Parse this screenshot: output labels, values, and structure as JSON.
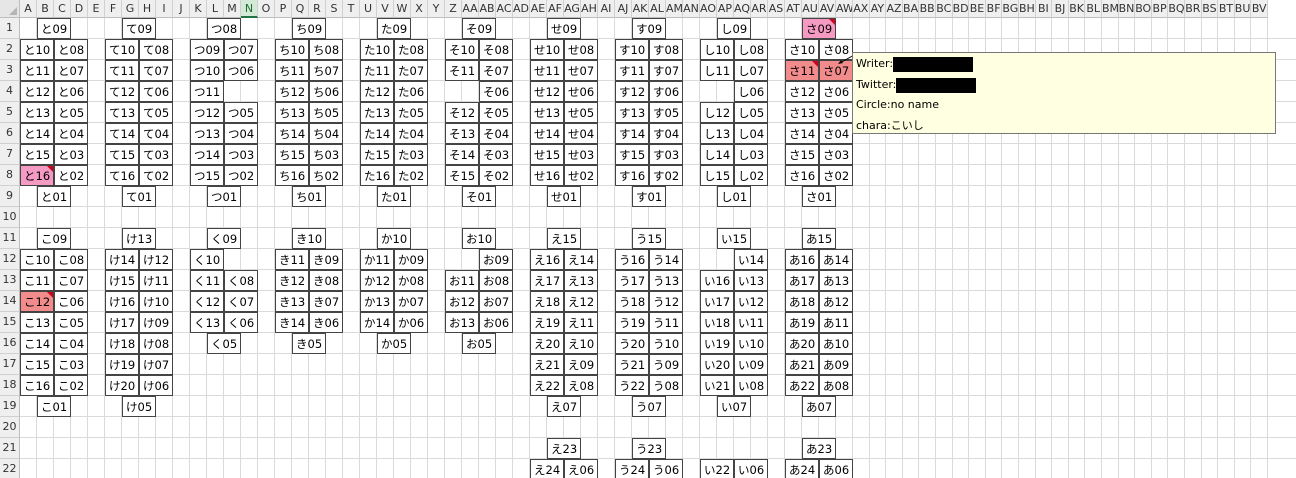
{
  "column_headers": [
    "A",
    "B",
    "C",
    "D",
    "E",
    "F",
    "G",
    "H",
    "I",
    "J",
    "K",
    "L",
    "M",
    "N",
    "O",
    "P",
    "Q",
    "R",
    "S",
    "T",
    "U",
    "V",
    "W",
    "X",
    "Y",
    "Z",
    "AA",
    "AB",
    "AC",
    "AD",
    "AE",
    "AF",
    "AG",
    "AH",
    "AI",
    "AJ",
    "AK",
    "AL",
    "AM",
    "AN",
    "AO",
    "AP",
    "AQ",
    "AR",
    "AS",
    "AT",
    "AU",
    "AV",
    "AW",
    "AX",
    "AY",
    "AZ",
    "BA",
    "BB",
    "BC",
    "BD",
    "BE",
    "BF",
    "BG",
    "BH",
    "BI",
    "BJ",
    "BK",
    "BL",
    "BM",
    "BN",
    "BO",
    "BP",
    "BQ",
    "BR",
    "BS",
    "BT",
    "BU",
    "BV"
  ],
  "selected_column": "N",
  "row_headers": [
    "1",
    "2",
    "3",
    "4",
    "5",
    "6",
    "7",
    "8",
    "9",
    "10",
    "11",
    "12",
    "13",
    "14",
    "15",
    "16",
    "17",
    "18",
    "19",
    "20",
    "21",
    "22"
  ],
  "cells": [
    {
      "r": 1,
      "c": "B",
      "t": "と09"
    },
    {
      "r": 2,
      "c": "A",
      "t": "と10"
    },
    {
      "r": 2,
      "c": "C",
      "t": "と08"
    },
    {
      "r": 3,
      "c": "A",
      "t": "と11"
    },
    {
      "r": 3,
      "c": "C",
      "t": "と07"
    },
    {
      "r": 4,
      "c": "A",
      "t": "と12"
    },
    {
      "r": 4,
      "c": "C",
      "t": "と06"
    },
    {
      "r": 5,
      "c": "A",
      "t": "と13"
    },
    {
      "r": 5,
      "c": "C",
      "t": "と05"
    },
    {
      "r": 6,
      "c": "A",
      "t": "と14"
    },
    {
      "r": 6,
      "c": "C",
      "t": "と04"
    },
    {
      "r": 7,
      "c": "A",
      "t": "と15"
    },
    {
      "r": 7,
      "c": "C",
      "t": "と03"
    },
    {
      "r": 8,
      "c": "A",
      "t": "と16",
      "hl": "pink",
      "note": true
    },
    {
      "r": 8,
      "c": "C",
      "t": "と02"
    },
    {
      "r": 9,
      "c": "B",
      "t": "と01"
    },
    {
      "r": 11,
      "c": "B",
      "t": "こ09"
    },
    {
      "r": 12,
      "c": "A",
      "t": "こ10"
    },
    {
      "r": 12,
      "c": "C",
      "t": "こ08"
    },
    {
      "r": 13,
      "c": "A",
      "t": "こ11"
    },
    {
      "r": 13,
      "c": "C",
      "t": "こ07"
    },
    {
      "r": 14,
      "c": "A",
      "t": "こ12",
      "hl": "red",
      "note": true
    },
    {
      "r": 14,
      "c": "C",
      "t": "こ06"
    },
    {
      "r": 15,
      "c": "A",
      "t": "こ13"
    },
    {
      "r": 15,
      "c": "C",
      "t": "こ05"
    },
    {
      "r": 16,
      "c": "A",
      "t": "こ14"
    },
    {
      "r": 16,
      "c": "C",
      "t": "こ04"
    },
    {
      "r": 17,
      "c": "A",
      "t": "こ15"
    },
    {
      "r": 17,
      "c": "C",
      "t": "こ03"
    },
    {
      "r": 18,
      "c": "A",
      "t": "こ16"
    },
    {
      "r": 18,
      "c": "C",
      "t": "こ02"
    },
    {
      "r": 19,
      "c": "B",
      "t": "こ01"
    },
    {
      "r": 1,
      "c": "G",
      "t": "て09"
    },
    {
      "r": 2,
      "c": "F",
      "t": "て10"
    },
    {
      "r": 2,
      "c": "H",
      "t": "て08"
    },
    {
      "r": 3,
      "c": "F",
      "t": "て11"
    },
    {
      "r": 3,
      "c": "H",
      "t": "て07"
    },
    {
      "r": 4,
      "c": "F",
      "t": "て12"
    },
    {
      "r": 4,
      "c": "H",
      "t": "て06"
    },
    {
      "r": 5,
      "c": "F",
      "t": "て13"
    },
    {
      "r": 5,
      "c": "H",
      "t": "て05"
    },
    {
      "r": 6,
      "c": "F",
      "t": "て14"
    },
    {
      "r": 6,
      "c": "H",
      "t": "て04"
    },
    {
      "r": 7,
      "c": "F",
      "t": "て15"
    },
    {
      "r": 7,
      "c": "H",
      "t": "て03"
    },
    {
      "r": 8,
      "c": "F",
      "t": "て16"
    },
    {
      "r": 8,
      "c": "H",
      "t": "て02"
    },
    {
      "r": 9,
      "c": "G",
      "t": "て01"
    },
    {
      "r": 11,
      "c": "G",
      "t": "け13"
    },
    {
      "r": 12,
      "c": "F",
      "t": "け14"
    },
    {
      "r": 12,
      "c": "H",
      "t": "け12"
    },
    {
      "r": 13,
      "c": "F",
      "t": "け15"
    },
    {
      "r": 13,
      "c": "H",
      "t": "け11"
    },
    {
      "r": 14,
      "c": "F",
      "t": "け16"
    },
    {
      "r": 14,
      "c": "H",
      "t": "け10"
    },
    {
      "r": 15,
      "c": "F",
      "t": "け17"
    },
    {
      "r": 15,
      "c": "H",
      "t": "け09"
    },
    {
      "r": 16,
      "c": "F",
      "t": "け18"
    },
    {
      "r": 16,
      "c": "H",
      "t": "け08"
    },
    {
      "r": 17,
      "c": "F",
      "t": "け19"
    },
    {
      "r": 17,
      "c": "H",
      "t": "け07"
    },
    {
      "r": 18,
      "c": "F",
      "t": "け20"
    },
    {
      "r": 18,
      "c": "H",
      "t": "け06"
    },
    {
      "r": 19,
      "c": "G",
      "t": "け05"
    },
    {
      "r": 1,
      "c": "L",
      "t": "つ08"
    },
    {
      "r": 2,
      "c": "K",
      "t": "つ09"
    },
    {
      "r": 2,
      "c": "M",
      "t": "つ07"
    },
    {
      "r": 3,
      "c": "K",
      "t": "つ10"
    },
    {
      "r": 3,
      "c": "M",
      "t": "つ06"
    },
    {
      "r": 4,
      "c": "K",
      "t": "つ11"
    },
    {
      "r": 5,
      "c": "K",
      "t": "つ12"
    },
    {
      "r": 5,
      "c": "M",
      "t": "つ05"
    },
    {
      "r": 6,
      "c": "K",
      "t": "つ13"
    },
    {
      "r": 6,
      "c": "M",
      "t": "つ04"
    },
    {
      "r": 7,
      "c": "K",
      "t": "つ14"
    },
    {
      "r": 7,
      "c": "M",
      "t": "つ03"
    },
    {
      "r": 8,
      "c": "K",
      "t": "つ15"
    },
    {
      "r": 8,
      "c": "M",
      "t": "つ02"
    },
    {
      "r": 9,
      "c": "L",
      "t": "つ01"
    },
    {
      "r": 11,
      "c": "L",
      "t": "く09"
    },
    {
      "r": 12,
      "c": "K",
      "t": "く10"
    },
    {
      "r": 13,
      "c": "K",
      "t": "く11"
    },
    {
      "r": 13,
      "c": "M",
      "t": "く08"
    },
    {
      "r": 14,
      "c": "K",
      "t": "く12"
    },
    {
      "r": 14,
      "c": "M",
      "t": "く07"
    },
    {
      "r": 15,
      "c": "K",
      "t": "く13"
    },
    {
      "r": 15,
      "c": "M",
      "t": "く06"
    },
    {
      "r": 16,
      "c": "L",
      "t": "く05"
    },
    {
      "r": 1,
      "c": "Q",
      "t": "ち09"
    },
    {
      "r": 2,
      "c": "P",
      "t": "ち10"
    },
    {
      "r": 2,
      "c": "R",
      "t": "ち08"
    },
    {
      "r": 3,
      "c": "P",
      "t": "ち11"
    },
    {
      "r": 3,
      "c": "R",
      "t": "ち07"
    },
    {
      "r": 4,
      "c": "P",
      "t": "ち12"
    },
    {
      "r": 4,
      "c": "R",
      "t": "ち06"
    },
    {
      "r": 5,
      "c": "P",
      "t": "ち13"
    },
    {
      "r": 5,
      "c": "R",
      "t": "ち05"
    },
    {
      "r": 6,
      "c": "P",
      "t": "ち14"
    },
    {
      "r": 6,
      "c": "R",
      "t": "ち04"
    },
    {
      "r": 7,
      "c": "P",
      "t": "ち15"
    },
    {
      "r": 7,
      "c": "R",
      "t": "ち03"
    },
    {
      "r": 8,
      "c": "P",
      "t": "ち16"
    },
    {
      "r": 8,
      "c": "R",
      "t": "ち02"
    },
    {
      "r": 9,
      "c": "Q",
      "t": "ち01"
    },
    {
      "r": 11,
      "c": "Q",
      "t": "き10"
    },
    {
      "r": 12,
      "c": "P",
      "t": "き11"
    },
    {
      "r": 12,
      "c": "R",
      "t": "き09"
    },
    {
      "r": 13,
      "c": "P",
      "t": "き12"
    },
    {
      "r": 13,
      "c": "R",
      "t": "き08"
    },
    {
      "r": 14,
      "c": "P",
      "t": "き13"
    },
    {
      "r": 14,
      "c": "R",
      "t": "き07"
    },
    {
      "r": 15,
      "c": "P",
      "t": "き14"
    },
    {
      "r": 15,
      "c": "R",
      "t": "き06"
    },
    {
      "r": 16,
      "c": "Q",
      "t": "き05"
    },
    {
      "r": 1,
      "c": "V",
      "t": "た09"
    },
    {
      "r": 2,
      "c": "U",
      "t": "た10"
    },
    {
      "r": 2,
      "c": "W",
      "t": "た08"
    },
    {
      "r": 3,
      "c": "U",
      "t": "た11"
    },
    {
      "r": 3,
      "c": "W",
      "t": "た07"
    },
    {
      "r": 4,
      "c": "U",
      "t": "た12"
    },
    {
      "r": 4,
      "c": "W",
      "t": "た06"
    },
    {
      "r": 5,
      "c": "U",
      "t": "た13"
    },
    {
      "r": 5,
      "c": "W",
      "t": "た05"
    },
    {
      "r": 6,
      "c": "U",
      "t": "た14"
    },
    {
      "r": 6,
      "c": "W",
      "t": "た04"
    },
    {
      "r": 7,
      "c": "U",
      "t": "た15"
    },
    {
      "r": 7,
      "c": "W",
      "t": "た03"
    },
    {
      "r": 8,
      "c": "U",
      "t": "た16"
    },
    {
      "r": 8,
      "c": "W",
      "t": "た02"
    },
    {
      "r": 9,
      "c": "V",
      "t": "た01"
    },
    {
      "r": 11,
      "c": "V",
      "t": "か10"
    },
    {
      "r": 12,
      "c": "U",
      "t": "か11"
    },
    {
      "r": 12,
      "c": "W",
      "t": "か09"
    },
    {
      "r": 13,
      "c": "U",
      "t": "か12"
    },
    {
      "r": 13,
      "c": "W",
      "t": "か08"
    },
    {
      "r": 14,
      "c": "U",
      "t": "か13"
    },
    {
      "r": 14,
      "c": "W",
      "t": "か07"
    },
    {
      "r": 15,
      "c": "U",
      "t": "か14"
    },
    {
      "r": 15,
      "c": "W",
      "t": "か06"
    },
    {
      "r": 16,
      "c": "V",
      "t": "か05"
    },
    {
      "r": 1,
      "c": "AA",
      "t": "そ09"
    },
    {
      "r": 2,
      "c": "Z",
      "t": "そ10"
    },
    {
      "r": 2,
      "c": "AB",
      "t": "そ08"
    },
    {
      "r": 3,
      "c": "Z",
      "t": "そ11"
    },
    {
      "r": 3,
      "c": "AB",
      "t": "そ07"
    },
    {
      "r": 4,
      "c": "AB",
      "t": "そ06"
    },
    {
      "r": 5,
      "c": "Z",
      "t": "そ12"
    },
    {
      "r": 5,
      "c": "AB",
      "t": "そ05"
    },
    {
      "r": 6,
      "c": "Z",
      "t": "そ13"
    },
    {
      "r": 6,
      "c": "AB",
      "t": "そ04"
    },
    {
      "r": 7,
      "c": "Z",
      "t": "そ14"
    },
    {
      "r": 7,
      "c": "AB",
      "t": "そ03"
    },
    {
      "r": 8,
      "c": "Z",
      "t": "そ15"
    },
    {
      "r": 8,
      "c": "AB",
      "t": "そ02"
    },
    {
      "r": 9,
      "c": "AA",
      "t": "そ01"
    },
    {
      "r": 11,
      "c": "AA",
      "t": "お10"
    },
    {
      "r": 12,
      "c": "AB",
      "t": "お09"
    },
    {
      "r": 13,
      "c": "Z",
      "t": "お11"
    },
    {
      "r": 13,
      "c": "AB",
      "t": "お08"
    },
    {
      "r": 14,
      "c": "Z",
      "t": "お12"
    },
    {
      "r": 14,
      "c": "AB",
      "t": "お07"
    },
    {
      "r": 15,
      "c": "Z",
      "t": "お13"
    },
    {
      "r": 15,
      "c": "AB",
      "t": "お06"
    },
    {
      "r": 16,
      "c": "AA",
      "t": "お05"
    },
    {
      "r": 1,
      "c": "AF",
      "t": "せ09"
    },
    {
      "r": 2,
      "c": "AE",
      "t": "せ10"
    },
    {
      "r": 2,
      "c": "AG",
      "t": "せ08"
    },
    {
      "r": 3,
      "c": "AE",
      "t": "せ11"
    },
    {
      "r": 3,
      "c": "AG",
      "t": "せ07"
    },
    {
      "r": 4,
      "c": "AE",
      "t": "せ12"
    },
    {
      "r": 4,
      "c": "AG",
      "t": "せ06"
    },
    {
      "r": 5,
      "c": "AE",
      "t": "せ13"
    },
    {
      "r": 5,
      "c": "AG",
      "t": "せ05"
    },
    {
      "r": 6,
      "c": "AE",
      "t": "せ14"
    },
    {
      "r": 6,
      "c": "AG",
      "t": "せ04"
    },
    {
      "r": 7,
      "c": "AE",
      "t": "せ15"
    },
    {
      "r": 7,
      "c": "AG",
      "t": "せ03"
    },
    {
      "r": 8,
      "c": "AE",
      "t": "せ16"
    },
    {
      "r": 8,
      "c": "AG",
      "t": "せ02"
    },
    {
      "r": 9,
      "c": "AF",
      "t": "せ01"
    },
    {
      "r": 11,
      "c": "AF",
      "t": "え15"
    },
    {
      "r": 12,
      "c": "AE",
      "t": "え16"
    },
    {
      "r": 12,
      "c": "AG",
      "t": "え14"
    },
    {
      "r": 13,
      "c": "AE",
      "t": "え17"
    },
    {
      "r": 13,
      "c": "AG",
      "t": "え13"
    },
    {
      "r": 14,
      "c": "AE",
      "t": "え18"
    },
    {
      "r": 14,
      "c": "AG",
      "t": "え12"
    },
    {
      "r": 15,
      "c": "AE",
      "t": "え19"
    },
    {
      "r": 15,
      "c": "AG",
      "t": "え11"
    },
    {
      "r": 16,
      "c": "AE",
      "t": "え20"
    },
    {
      "r": 16,
      "c": "AG",
      "t": "え10"
    },
    {
      "r": 17,
      "c": "AE",
      "t": "え21"
    },
    {
      "r": 17,
      "c": "AG",
      "t": "え09"
    },
    {
      "r": 18,
      "c": "AE",
      "t": "え22"
    },
    {
      "r": 18,
      "c": "AG",
      "t": "え08"
    },
    {
      "r": 19,
      "c": "AF",
      "t": "え07"
    },
    {
      "r": 21,
      "c": "AF",
      "t": "え23"
    },
    {
      "r": 22,
      "c": "AE",
      "t": "え24"
    },
    {
      "r": 22,
      "c": "AG",
      "t": "え06"
    },
    {
      "r": 1,
      "c": "AK",
      "t": "す09"
    },
    {
      "r": 2,
      "c": "AJ",
      "t": "す10"
    },
    {
      "r": 2,
      "c": "AL",
      "t": "す08"
    },
    {
      "r": 3,
      "c": "AJ",
      "t": "す11"
    },
    {
      "r": 3,
      "c": "AL",
      "t": "す07"
    },
    {
      "r": 4,
      "c": "AJ",
      "t": "す12"
    },
    {
      "r": 4,
      "c": "AL",
      "t": "す06"
    },
    {
      "r": 5,
      "c": "AJ",
      "t": "す13"
    },
    {
      "r": 5,
      "c": "AL",
      "t": "す05"
    },
    {
      "r": 6,
      "c": "AJ",
      "t": "す14"
    },
    {
      "r": 6,
      "c": "AL",
      "t": "す04"
    },
    {
      "r": 7,
      "c": "AJ",
      "t": "す15"
    },
    {
      "r": 7,
      "c": "AL",
      "t": "す03"
    },
    {
      "r": 8,
      "c": "AJ",
      "t": "す16"
    },
    {
      "r": 8,
      "c": "AL",
      "t": "す02"
    },
    {
      "r": 9,
      "c": "AK",
      "t": "す01"
    },
    {
      "r": 11,
      "c": "AK",
      "t": "う15"
    },
    {
      "r": 12,
      "c": "AJ",
      "t": "う16"
    },
    {
      "r": 12,
      "c": "AL",
      "t": "う14"
    },
    {
      "r": 13,
      "c": "AJ",
      "t": "う17"
    },
    {
      "r": 13,
      "c": "AL",
      "t": "う13"
    },
    {
      "r": 14,
      "c": "AJ",
      "t": "う18"
    },
    {
      "r": 14,
      "c": "AL",
      "t": "う12"
    },
    {
      "r": 15,
      "c": "AJ",
      "t": "う19"
    },
    {
      "r": 15,
      "c": "AL",
      "t": "う11"
    },
    {
      "r": 16,
      "c": "AJ",
      "t": "う20"
    },
    {
      "r": 16,
      "c": "AL",
      "t": "う10"
    },
    {
      "r": 17,
      "c": "AJ",
      "t": "う21"
    },
    {
      "r": 17,
      "c": "AL",
      "t": "う09"
    },
    {
      "r": 18,
      "c": "AJ",
      "t": "う22"
    },
    {
      "r": 18,
      "c": "AL",
      "t": "う08"
    },
    {
      "r": 19,
      "c": "AK",
      "t": "う07"
    },
    {
      "r": 21,
      "c": "AK",
      "t": "う23"
    },
    {
      "r": 22,
      "c": "AJ",
      "t": "う24"
    },
    {
      "r": 22,
      "c": "AL",
      "t": "う06"
    },
    {
      "r": 1,
      "c": "AP",
      "t": "し09"
    },
    {
      "r": 2,
      "c": "AO",
      "t": "し10"
    },
    {
      "r": 2,
      "c": "AQ",
      "t": "し08"
    },
    {
      "r": 3,
      "c": "AO",
      "t": "し11"
    },
    {
      "r": 3,
      "c": "AQ",
      "t": "し07"
    },
    {
      "r": 4,
      "c": "AQ",
      "t": "し06"
    },
    {
      "r": 5,
      "c": "AO",
      "t": "し12"
    },
    {
      "r": 5,
      "c": "AQ",
      "t": "し05"
    },
    {
      "r": 6,
      "c": "AO",
      "t": "し13"
    },
    {
      "r": 6,
      "c": "AQ",
      "t": "し04"
    },
    {
      "r": 7,
      "c": "AO",
      "t": "し14"
    },
    {
      "r": 7,
      "c": "AQ",
      "t": "し03"
    },
    {
      "r": 8,
      "c": "AO",
      "t": "し15"
    },
    {
      "r": 8,
      "c": "AQ",
      "t": "し02"
    },
    {
      "r": 9,
      "c": "AP",
      "t": "し01"
    },
    {
      "r": 11,
      "c": "AP",
      "t": "い15"
    },
    {
      "r": 12,
      "c": "AQ",
      "t": "い14"
    },
    {
      "r": 13,
      "c": "AO",
      "t": "い16"
    },
    {
      "r": 13,
      "c": "AQ",
      "t": "い13"
    },
    {
      "r": 14,
      "c": "AO",
      "t": "い17"
    },
    {
      "r": 14,
      "c": "AQ",
      "t": "い12"
    },
    {
      "r": 15,
      "c": "AO",
      "t": "い18"
    },
    {
      "r": 15,
      "c": "AQ",
      "t": "い11"
    },
    {
      "r": 16,
      "c": "AO",
      "t": "い19"
    },
    {
      "r": 16,
      "c": "AQ",
      "t": "い10"
    },
    {
      "r": 17,
      "c": "AO",
      "t": "い20"
    },
    {
      "r": 17,
      "c": "AQ",
      "t": "い09"
    },
    {
      "r": 18,
      "c": "AO",
      "t": "い21"
    },
    {
      "r": 18,
      "c": "AQ",
      "t": "い08"
    },
    {
      "r": 19,
      "c": "AP",
      "t": "い07"
    },
    {
      "r": 22,
      "c": "AO",
      "t": "い22"
    },
    {
      "r": 22,
      "c": "AQ",
      "t": "い06"
    },
    {
      "r": 1,
      "c": "AU",
      "t": "さ09",
      "hl": "pink",
      "note": true
    },
    {
      "r": 2,
      "c": "AT",
      "t": "さ10"
    },
    {
      "r": 2,
      "c": "AV",
      "t": "さ08"
    },
    {
      "r": 3,
      "c": "AT",
      "t": "さ11",
      "hl": "red",
      "note": true
    },
    {
      "r": 3,
      "c": "AV",
      "t": "さ07",
      "hl": "red"
    },
    {
      "r": 4,
      "c": "AT",
      "t": "さ12"
    },
    {
      "r": 4,
      "c": "AV",
      "t": "さ06"
    },
    {
      "r": 5,
      "c": "AT",
      "t": "さ13"
    },
    {
      "r": 5,
      "c": "AV",
      "t": "さ05"
    },
    {
      "r": 6,
      "c": "AT",
      "t": "さ14"
    },
    {
      "r": 6,
      "c": "AV",
      "t": "さ04"
    },
    {
      "r": 7,
      "c": "AT",
      "t": "さ15"
    },
    {
      "r": 7,
      "c": "AV",
      "t": "さ03"
    },
    {
      "r": 8,
      "c": "AT",
      "t": "さ16"
    },
    {
      "r": 8,
      "c": "AV",
      "t": "さ02"
    },
    {
      "r": 9,
      "c": "AU",
      "t": "さ01"
    },
    {
      "r": 11,
      "c": "AU",
      "t": "あ15"
    },
    {
      "r": 12,
      "c": "AT",
      "t": "あ16"
    },
    {
      "r": 12,
      "c": "AV",
      "t": "あ14"
    },
    {
      "r": 13,
      "c": "AT",
      "t": "あ17"
    },
    {
      "r": 13,
      "c": "AV",
      "t": "あ13"
    },
    {
      "r": 14,
      "c": "AT",
      "t": "あ18"
    },
    {
      "r": 14,
      "c": "AV",
      "t": "あ12"
    },
    {
      "r": 15,
      "c": "AT",
      "t": "あ19"
    },
    {
      "r": 15,
      "c": "AV",
      "t": "あ11"
    },
    {
      "r": 16,
      "c": "AT",
      "t": "あ20"
    },
    {
      "r": 16,
      "c": "AV",
      "t": "あ10"
    },
    {
      "r": 17,
      "c": "AT",
      "t": "あ21"
    },
    {
      "r": 17,
      "c": "AV",
      "t": "あ09"
    },
    {
      "r": 18,
      "c": "AT",
      "t": "あ22"
    },
    {
      "r": 18,
      "c": "AV",
      "t": "あ08"
    },
    {
      "r": 19,
      "c": "AU",
      "t": "あ07"
    },
    {
      "r": 21,
      "c": "AU",
      "t": "あ23"
    },
    {
      "r": 22,
      "c": "AT",
      "t": "あ24"
    },
    {
      "r": 22,
      "c": "AV",
      "t": "あ06"
    }
  ],
  "comment": {
    "writer_label": "Writer:",
    "twitter_label": "Twitter:",
    "circle_line": "Circle:no name",
    "chara_line": "chara:こいし"
  },
  "colors": {
    "pink": "#f59ac3",
    "red": "#f28b8b",
    "comment_bg": "#ffffe1",
    "selected_header": "#217346"
  }
}
